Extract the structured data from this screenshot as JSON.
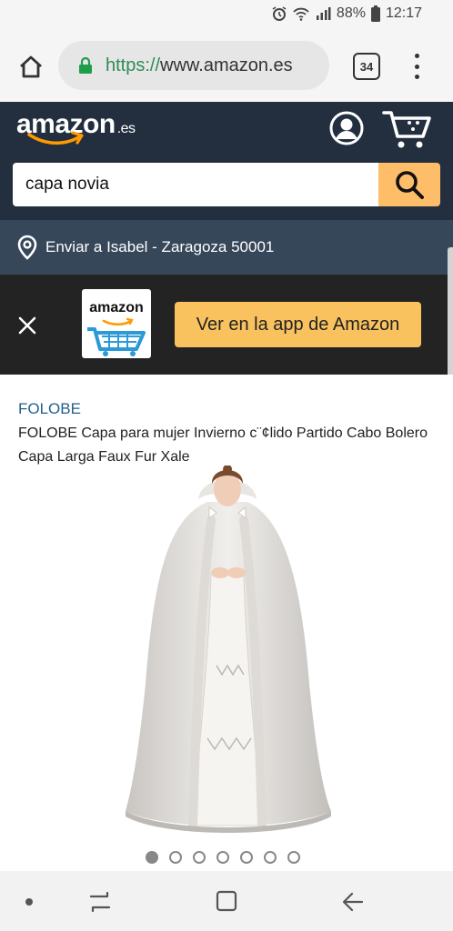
{
  "status_bar": {
    "battery": "88%",
    "time": "12:17"
  },
  "browser": {
    "url_scheme": "https://",
    "url_host": "www.amazon.es",
    "tab_count": "34"
  },
  "header": {
    "logo_text": "amazon",
    "logo_tld": ".es",
    "search": {
      "value": "capa novia"
    }
  },
  "delivery": {
    "text": "Enviar a Isabel - Zaragoza 50001"
  },
  "app_banner": {
    "tile_text": "amazon",
    "button_label": "Ver en la app de Amazon"
  },
  "product": {
    "brand": "FOLOBE",
    "title": "FOLOBE Capa para mujer Invierno c¨¢lido Partido Cabo Bolero Capa Larga Faux Fur Xale",
    "carousel": {
      "count": 7,
      "active_index": 0
    }
  },
  "colors": {
    "header_bg": "#232f3e",
    "delivery_bg": "#37475a",
    "search_button": "#febd69",
    "app_button": "#f9c25e",
    "brand_link": "#1f5f8b"
  }
}
